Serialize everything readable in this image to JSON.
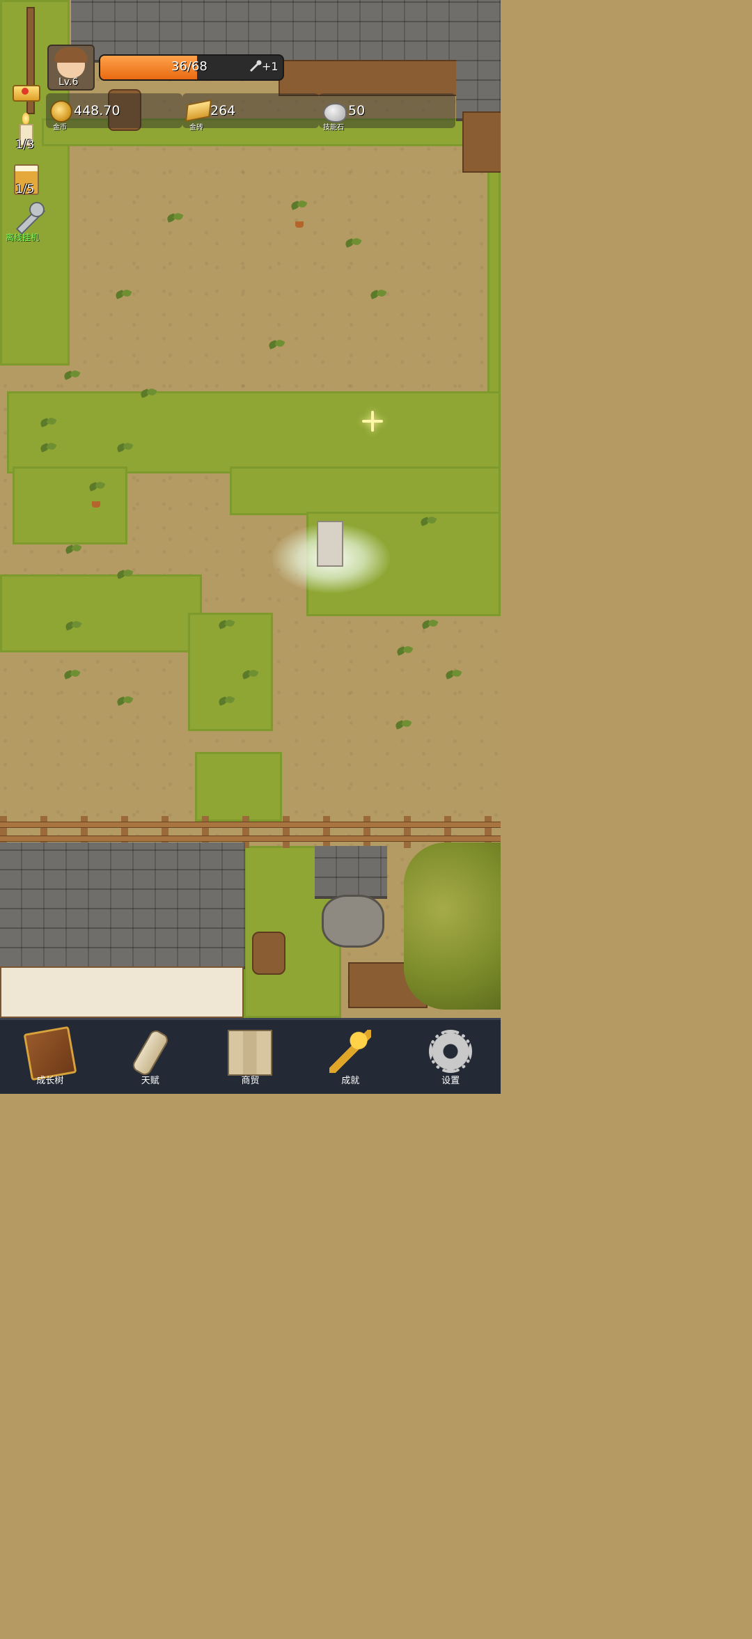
{
  "hud": {
    "level": "Lv.6",
    "xp": {
      "current": 36,
      "max": 68,
      "text": "36/68",
      "bonus": "+1",
      "fill_fraction": 0.53
    },
    "resources": [
      {
        "name": "金币",
        "value": "448.70",
        "icon": "gold-coin-icon"
      },
      {
        "name": "金砖",
        "value": "264",
        "icon": "gold-bar-icon"
      },
      {
        "name": "技能石",
        "value": "50",
        "icon": "skill-stone-icon"
      }
    ]
  },
  "side": {
    "crown_icon": "crown-icon",
    "candle": {
      "icon": "candle-icon",
      "count": "1/3"
    },
    "beer": {
      "icon": "beer-icon",
      "count": "1/5"
    },
    "idle": {
      "icon": "wrench-icon",
      "label": "离线挂机"
    }
  },
  "nav": [
    {
      "label": "成长树",
      "icon": "book-icon"
    },
    {
      "label": "天赋",
      "icon": "scroll-icon"
    },
    {
      "label": "商贸",
      "icon": "map-icon"
    },
    {
      "label": "成就",
      "icon": "key-icon"
    },
    {
      "label": "设置",
      "icon": "gear-icon"
    }
  ],
  "colors": {
    "xp_fill": "#f07a1e",
    "grass": "#8fa634",
    "dirt": "#b49a63",
    "nav_bg": "#242a35",
    "idle_label": "#7cff5a"
  }
}
